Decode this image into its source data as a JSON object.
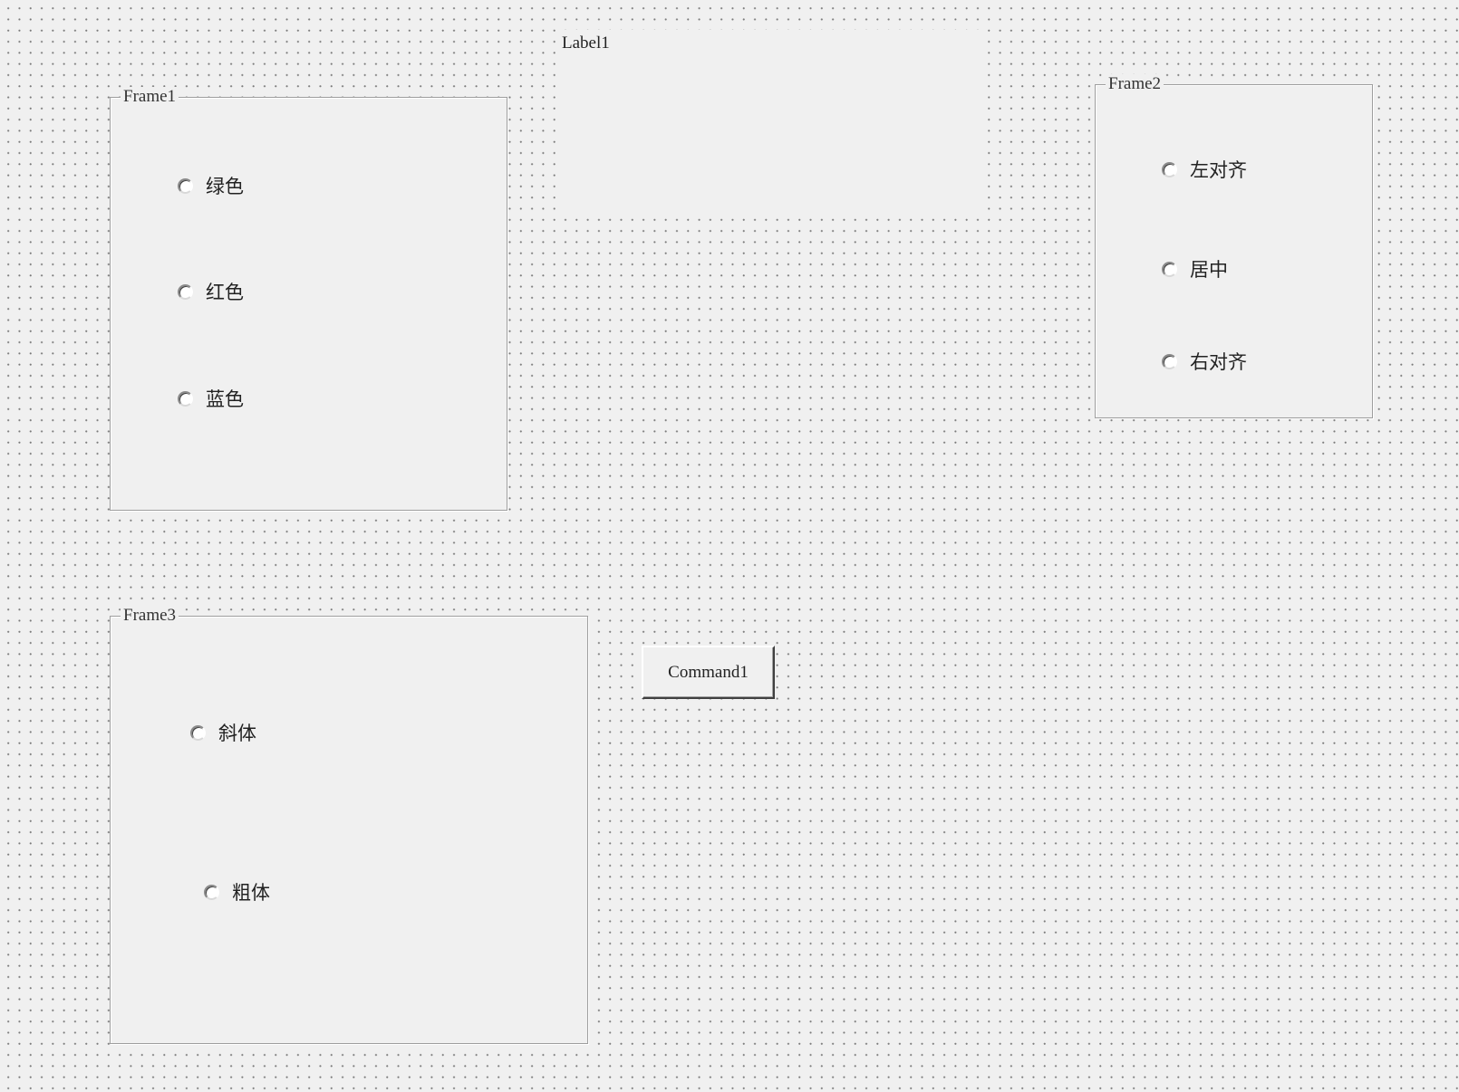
{
  "label1": {
    "text": "Label1"
  },
  "frame1": {
    "caption": "Frame1",
    "options": [
      {
        "label": "绿色",
        "selected": false
      },
      {
        "label": "红色",
        "selected": false
      },
      {
        "label": "蓝色",
        "selected": false
      }
    ]
  },
  "frame2": {
    "caption": "Frame2",
    "options": [
      {
        "label": "左对齐",
        "selected": false
      },
      {
        "label": "居中",
        "selected": false
      },
      {
        "label": "右对齐",
        "selected": false
      }
    ]
  },
  "frame3": {
    "caption": "Frame3",
    "options": [
      {
        "label": "斜体",
        "selected": false
      },
      {
        "label": "粗体",
        "selected": false
      }
    ]
  },
  "command1": {
    "label": "Command1"
  }
}
